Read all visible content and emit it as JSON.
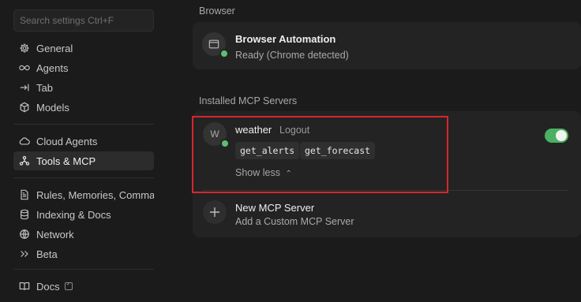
{
  "search": {
    "placeholder": "Search settings Ctrl+F"
  },
  "sidebar": {
    "items": [
      {
        "label": "General",
        "icon": "gear-icon"
      },
      {
        "label": "Agents",
        "icon": "infinity-icon"
      },
      {
        "label": "Tab",
        "icon": "arrow-right-bar-icon"
      },
      {
        "label": "Models",
        "icon": "cube-icon"
      },
      {
        "label": "Cloud Agents",
        "icon": "cloud-icon"
      },
      {
        "label": "Tools & MCP",
        "icon": "tools-icon",
        "active": true
      },
      {
        "label": "Rules, Memories, Comma...",
        "icon": "document-icon"
      },
      {
        "label": "Indexing & Docs",
        "icon": "database-icon"
      },
      {
        "label": "Network",
        "icon": "globe-icon"
      },
      {
        "label": "Beta",
        "icon": "chevrons-right-icon"
      },
      {
        "label": "Docs",
        "icon": "book-icon"
      }
    ]
  },
  "browser": {
    "section_label": "Browser",
    "title": "Browser Automation",
    "status": "Ready (Chrome detected)"
  },
  "mcp": {
    "section_label": "Installed MCP Servers",
    "server": {
      "avatar": "W",
      "name": "weather",
      "logout_label": "Logout",
      "tools": [
        "get_alerts",
        "get_forecast"
      ],
      "show_less": "Show less",
      "enabled": true
    },
    "new_server": {
      "title": "New MCP Server",
      "subtitle": "Add a Custom MCP Server"
    }
  },
  "colors": {
    "accent_green": "#4bb061",
    "highlight_red": "#d8262c"
  }
}
